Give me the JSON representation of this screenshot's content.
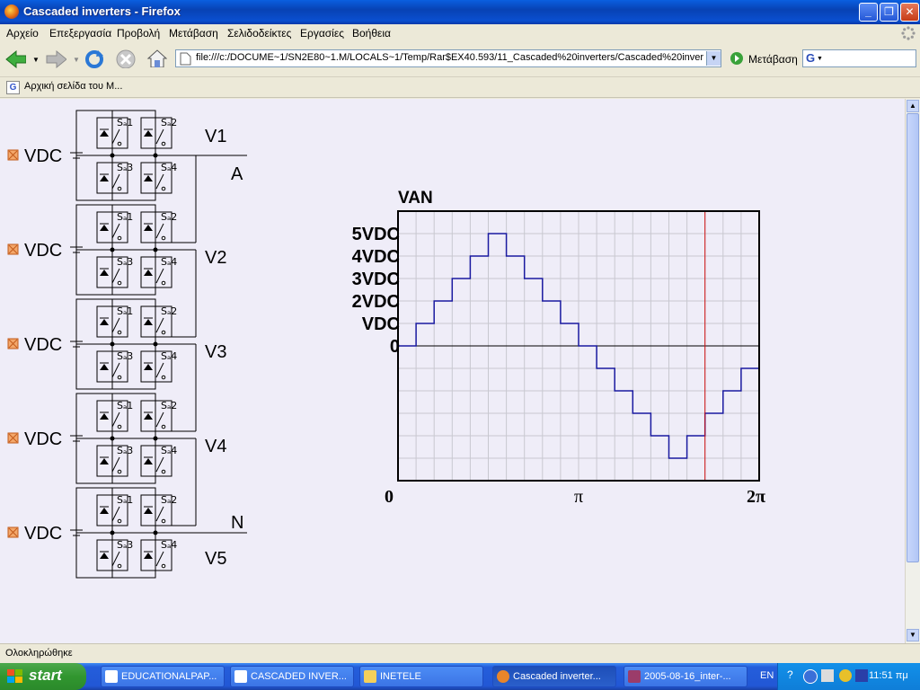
{
  "window": {
    "title": "Cascaded inverters - Firefox"
  },
  "menu": [
    "Αρχείο",
    "Επεξεργασία",
    "Προβολή",
    "Μετάβαση",
    "Σελιδοδείκτες",
    "Εργασίες",
    "Βοήθεια"
  ],
  "nav": {
    "url": "file:///c:/DOCUME~1/SN2E80~1.M/LOCALS~1/Temp/Rar$EX40.593/11_Cascaded%20inverters/Cascaded%20invert",
    "go_label": "Μετάβαση",
    "search_value": ""
  },
  "bookmarks": {
    "item": "Αρχική σελίδα του Μ..."
  },
  "circuit": {
    "cell_label": "VDC",
    "switch_labels": [
      "Sₐ1",
      "Sₐ2",
      "Sₐ3",
      "Sₐ4"
    ],
    "outputs": [
      "V1",
      "V2",
      "V3",
      "V4",
      "V5"
    ],
    "node_a": "A",
    "node_n": "N"
  },
  "chart_data": {
    "type": "line",
    "title": "VAN",
    "ytick_labels": [
      "5VDC",
      "4VDC",
      "3VDC",
      "2VDC",
      "VDC",
      "0"
    ],
    "xtick_labels": [
      "0",
      "π",
      "2π"
    ],
    "xlim": [
      0,
      2
    ],
    "ylim": [
      -6,
      6
    ],
    "x_unit": "π",
    "series": [
      {
        "x": [
          0,
          0.1,
          0.2,
          0.3,
          0.4,
          0.5,
          0.6,
          0.7,
          0.8,
          0.9,
          1.0,
          1.1,
          1.2,
          1.3,
          1.4,
          1.5,
          1.6,
          1.7,
          1.8,
          1.9,
          2.0
        ],
        "values": [
          0,
          1,
          2,
          3,
          4,
          5,
          4,
          3,
          2,
          1,
          0,
          -1,
          -2,
          -3,
          -4,
          -5,
          -4,
          -3,
          -2,
          -1,
          -1
        ]
      }
    ],
    "cursor_x": 1.7,
    "colors": {
      "line": "#1a1aa0",
      "cursor": "#d01010",
      "grid": "#c8c8d0"
    }
  },
  "status": {
    "text": "Ολοκληρώθηκε"
  },
  "taskbar": {
    "start_label": "start",
    "tasks": [
      "EDUCATIONALPAP...",
      "CASCADED INVER...",
      "INETELE",
      "Cascaded inverter...",
      "2005-08-16_inter-..."
    ],
    "lang": "EN",
    "clock": "11:51 πμ"
  }
}
